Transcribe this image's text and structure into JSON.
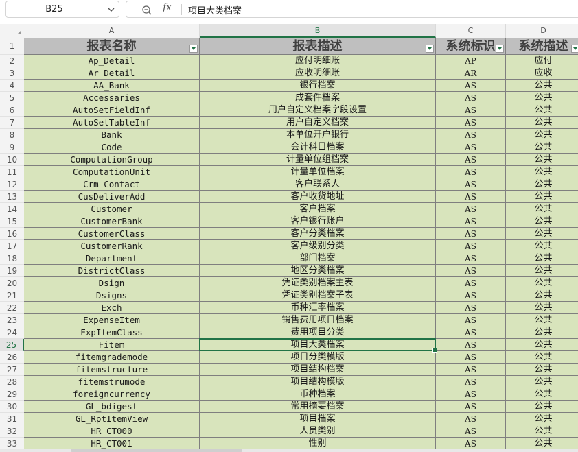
{
  "formula_bar": {
    "name_box": "B25",
    "fx_label": "fx",
    "formula": "项目大类档案"
  },
  "selected_cell": {
    "col": "B",
    "row": 25
  },
  "columns": [
    "A",
    "B",
    "C",
    "D"
  ],
  "header_row": {
    "row": 1,
    "cells": [
      "报表名称",
      "报表描述",
      "系统标识",
      "系统描述"
    ]
  },
  "rows": [
    {
      "num": 2,
      "cells": [
        "Ap_Detail",
        "应付明细账",
        "AP",
        "应付"
      ]
    },
    {
      "num": 3,
      "cells": [
        "Ar_Detail",
        "应收明细账",
        "AR",
        "应收"
      ]
    },
    {
      "num": 4,
      "cells": [
        "AA_Bank",
        "银行档案",
        "AS",
        "公共"
      ]
    },
    {
      "num": 5,
      "cells": [
        "Accessaries",
        "成套件档案",
        "AS",
        "公共"
      ]
    },
    {
      "num": 6,
      "cells": [
        "AutoSetFieldInf",
        "用户自定义档案字段设置",
        "AS",
        "公共"
      ]
    },
    {
      "num": 7,
      "cells": [
        "AutoSetTableInf",
        "用户自定义档案",
        "AS",
        "公共"
      ]
    },
    {
      "num": 8,
      "cells": [
        "Bank",
        "本单位开户银行",
        "AS",
        "公共"
      ]
    },
    {
      "num": 9,
      "cells": [
        "Code",
        "会计科目档案",
        "AS",
        "公共"
      ]
    },
    {
      "num": 10,
      "cells": [
        "ComputationGroup",
        "计量单位组档案",
        "AS",
        "公共"
      ]
    },
    {
      "num": 11,
      "cells": [
        "ComputationUnit",
        "计量单位档案",
        "AS",
        "公共"
      ]
    },
    {
      "num": 12,
      "cells": [
        "Crm_Contact",
        "客户联系人",
        "AS",
        "公共"
      ]
    },
    {
      "num": 13,
      "cells": [
        "CusDeliverAdd",
        "客户收货地址",
        "AS",
        "公共"
      ]
    },
    {
      "num": 14,
      "cells": [
        "Customer",
        "客户档案",
        "AS",
        "公共"
      ]
    },
    {
      "num": 15,
      "cells": [
        "CustomerBank",
        "客户银行账户",
        "AS",
        "公共"
      ]
    },
    {
      "num": 16,
      "cells": [
        "CustomerClass",
        "客户分类档案",
        "AS",
        "公共"
      ]
    },
    {
      "num": 17,
      "cells": [
        "CustomerRank",
        "客户级别分类",
        "AS",
        "公共"
      ]
    },
    {
      "num": 18,
      "cells": [
        "Department",
        "部门档案",
        "AS",
        "公共"
      ]
    },
    {
      "num": 19,
      "cells": [
        "DistrictClass",
        "地区分类档案",
        "AS",
        "公共"
      ]
    },
    {
      "num": 20,
      "cells": [
        "Dsign",
        "凭证类别档案主表",
        "AS",
        "公共"
      ]
    },
    {
      "num": 21,
      "cells": [
        "Dsigns",
        "凭证类别档案子表",
        "AS",
        "公共"
      ]
    },
    {
      "num": 22,
      "cells": [
        "Exch",
        "币种汇率档案",
        "AS",
        "公共"
      ]
    },
    {
      "num": 23,
      "cells": [
        "ExpenseItem",
        "销售费用项目档案",
        "AS",
        "公共"
      ]
    },
    {
      "num": 24,
      "cells": [
        "ExpItemClass",
        "费用项目分类",
        "AS",
        "公共"
      ]
    },
    {
      "num": 25,
      "cells": [
        "Fitem",
        "项目大类档案",
        "AS",
        "公共"
      ]
    },
    {
      "num": 26,
      "cells": [
        "fitemgrademode",
        "项目分类模版",
        "AS",
        "公共"
      ]
    },
    {
      "num": 27,
      "cells": [
        "fitemstructure",
        "项目结构档案",
        "AS",
        "公共"
      ]
    },
    {
      "num": 28,
      "cells": [
        "fitemstrumode",
        "项目结构模版",
        "AS",
        "公共"
      ]
    },
    {
      "num": 29,
      "cells": [
        "foreigncurrency",
        "币种档案",
        "AS",
        "公共"
      ]
    },
    {
      "num": 30,
      "cells": [
        "GL_bdigest",
        "常用摘要档案",
        "AS",
        "公共"
      ]
    },
    {
      "num": 31,
      "cells": [
        "GL_RptItemView",
        "项目档案",
        "AS",
        "公共"
      ]
    },
    {
      "num": 32,
      "cells": [
        "HR_CT000",
        "人员类别",
        "AS",
        "公共"
      ]
    },
    {
      "num": 33,
      "cells": [
        "HR_CT001",
        "性别",
        "AS",
        "公共"
      ]
    }
  ],
  "colors": {
    "cell_fill": "#d8e4bc",
    "header_fill": "#bfbfbf",
    "selection": "#217346"
  }
}
